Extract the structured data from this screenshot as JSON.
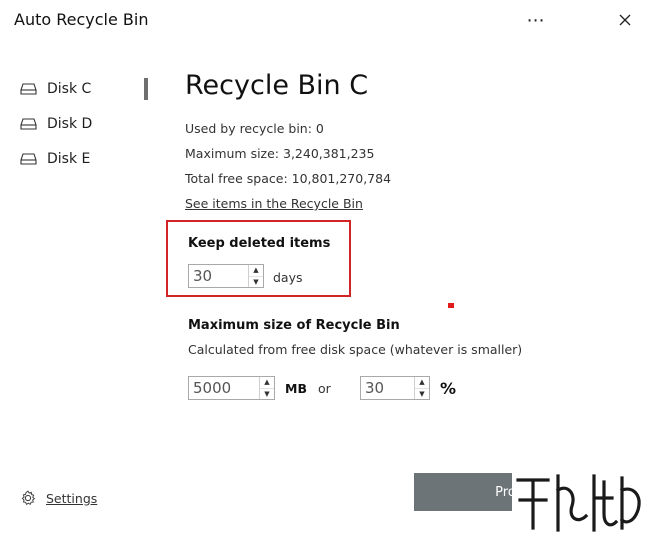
{
  "window": {
    "title": "Auto Recycle Bin",
    "more_label": "⋯",
    "close_label": "✕"
  },
  "sidebar": {
    "items": [
      {
        "label": "Disk C",
        "icon": "disk-icon"
      },
      {
        "label": "Disk D",
        "icon": "disk-icon"
      },
      {
        "label": "Disk E",
        "icon": "disk-icon"
      }
    ],
    "settings_label": "Settings",
    "settings_icon": "gear-icon"
  },
  "main": {
    "title": "Recycle Bin C",
    "used": "Used by recycle bin: 0",
    "max_size": "Maximum size: 3,240,381,235",
    "free_space": "Total free space: 10,801,270,784",
    "see_items_link": "See items in the Recycle Bin",
    "keep": {
      "title": "Keep deleted items",
      "value": "30",
      "unit": "days"
    },
    "maxsize": {
      "title": "Maximum size of Recycle Bin",
      "subtitle": "Calculated from free disk space (whatever is smaller)",
      "mb_value": "5000",
      "mb_unit": "MB",
      "or_label": "or",
      "pct_value": "30",
      "pct_unit": "%"
    },
    "proceed_label": "Proce"
  },
  "colors": {
    "highlight_border": "#d12424",
    "button_bg": "#6d7478",
    "accent_red": "#e01b1b"
  }
}
